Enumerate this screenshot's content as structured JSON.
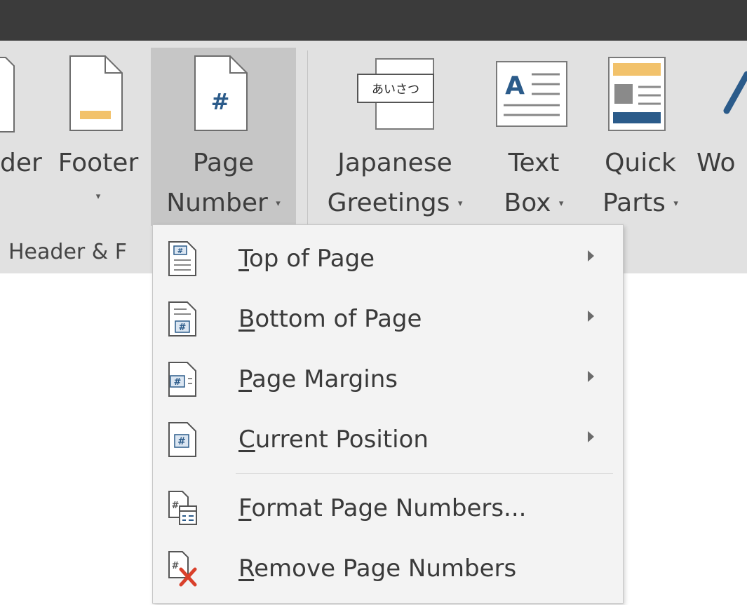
{
  "ribbon": {
    "header_partial": "der",
    "footer_label": "Footer",
    "page_number_line1": "Page",
    "page_number_line2": "Number",
    "japanese_line1": "Japanese",
    "japanese_line2": "Greetings",
    "japanese_icon_text": "あいさつ",
    "textbox_line1": "Text",
    "textbox_line2": "Box",
    "textbox_icon_text": "A",
    "quickparts_line1": "Quick",
    "quickparts_line2": "Parts",
    "wordart_partial": "Wo",
    "group_label": "Header & F",
    "dropdown_arrow": "▾"
  },
  "menu": {
    "items": [
      {
        "prefix": "",
        "key": "T",
        "rest": "op of Page",
        "submenu": true,
        "icon": "page-top-number-icon"
      },
      {
        "prefix": "",
        "key": "B",
        "rest": "ottom of Page",
        "submenu": true,
        "icon": "page-bottom-number-icon"
      },
      {
        "prefix": "",
        "key": "P",
        "rest": "age Margins",
        "submenu": true,
        "icon": "page-margin-number-icon"
      },
      {
        "prefix": "",
        "key": "C",
        "rest": "urrent Position",
        "submenu": true,
        "icon": "current-position-number-icon"
      },
      {
        "prefix": "",
        "key": "F",
        "rest": "ormat Page Numbers...",
        "submenu": false,
        "icon": "format-page-numbers-icon"
      },
      {
        "prefix": "",
        "key": "R",
        "rest": "emove Page Numbers",
        "submenu": false,
        "icon": "remove-page-numbers-icon"
      }
    ]
  },
  "colors": {
    "ribbon_bg": "#e1e1e1",
    "title_bar": "#3b3b3b",
    "selected_button": "#c6c6c6",
    "menu_bg": "#f3f3f3",
    "accent_blue": "#2b5b8a",
    "accent_gold": "#f2c26b",
    "remove_red": "#d9402b"
  }
}
